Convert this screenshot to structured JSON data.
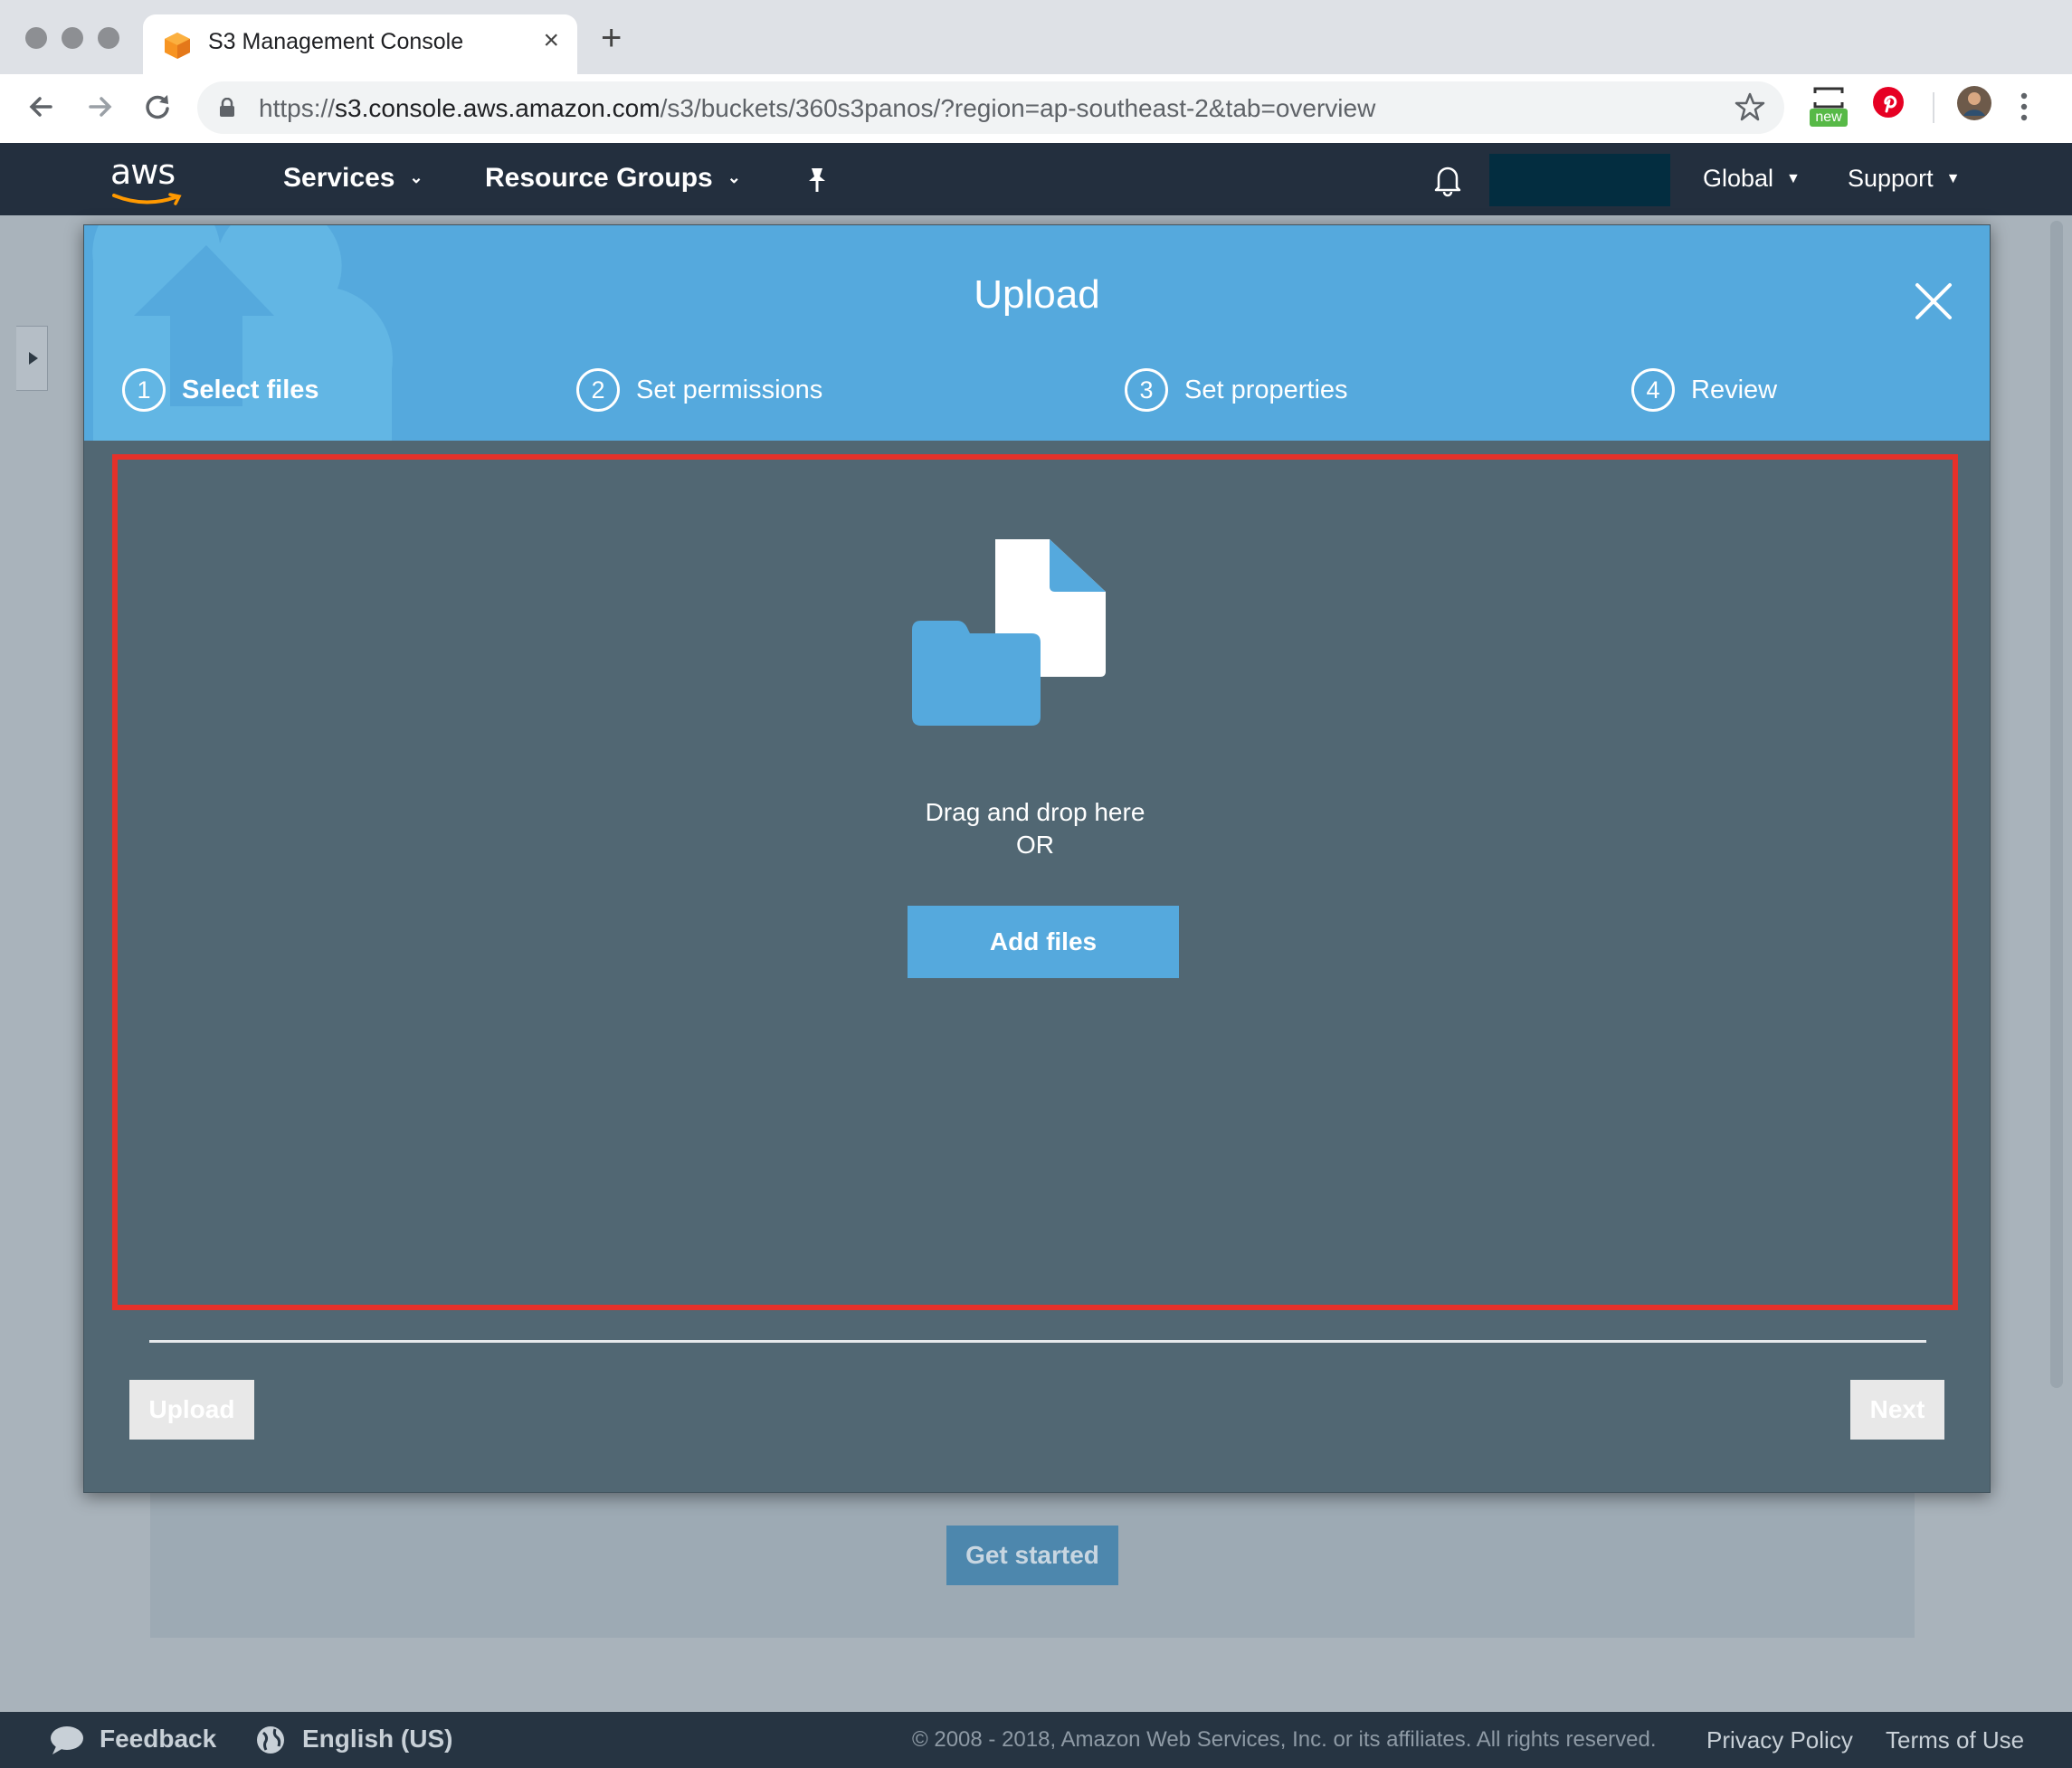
{
  "browser": {
    "tab_title": "S3 Management Console",
    "tab_close": "×",
    "new_tab": "+",
    "url_scheme": "https://",
    "url_host": "s3.console.aws.amazon.com",
    "url_path": "/s3/buckets/360s3panos/?region=ap-southeast-2&tab=overview",
    "ext_badge": "new"
  },
  "aws_header": {
    "logo": "aws",
    "services": "Services",
    "resource_groups": "Resource Groups",
    "region": "Global",
    "support": "Support"
  },
  "modal": {
    "title": "Upload",
    "steps": [
      {
        "num": "1",
        "label": "Select files"
      },
      {
        "num": "2",
        "label": "Set permissions"
      },
      {
        "num": "3",
        "label": "Set properties"
      },
      {
        "num": "4",
        "label": "Review"
      }
    ],
    "drop_line1": "Drag and drop here",
    "drop_line2": "OR",
    "add_files": "Add files",
    "upload_btn": "Upload",
    "next_btn": "Next"
  },
  "background": {
    "get_started": "Get started"
  },
  "footer": {
    "feedback": "Feedback",
    "language": "English (US)",
    "copyright": "© 2008 - 2018, Amazon Web Services, Inc. or its affiliates. All rights reserved.",
    "privacy": "Privacy Policy",
    "terms": "Terms of Use"
  },
  "colors": {
    "aws_nav": "#232f3e",
    "modal_header": "#55a9dd",
    "modal_body": "#516773",
    "highlight_border": "#e5312a"
  }
}
